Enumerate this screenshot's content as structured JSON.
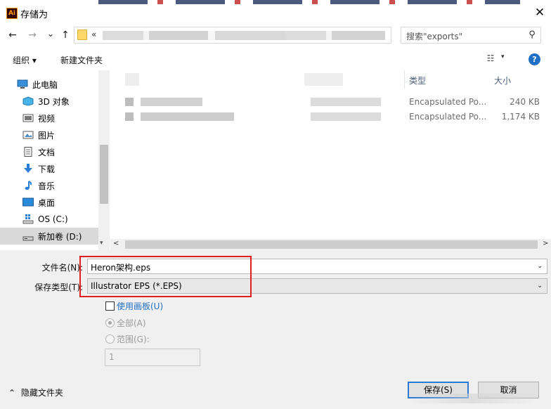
{
  "window": {
    "title": "存储为",
    "app_icon_text": "Ai",
    "close_glyph": "✕"
  },
  "nav": {
    "back_glyph": "←",
    "forward_glyph": "→",
    "recent_glyph": "⌄",
    "up_glyph": "↑",
    "breadcrumb_chevron": "«",
    "search_placeholder": "搜索\"exports\"",
    "search_glyph": "⚲"
  },
  "toolbar": {
    "organize_label": "组织 ▾",
    "new_folder_label": "新建文件夹",
    "view_glyph": "☷",
    "view_caret": "▾",
    "help_label": "?"
  },
  "tree": [
    {
      "label": "此电脑",
      "icon": "computer-icon",
      "selected": false
    },
    {
      "label": "3D 对象",
      "icon": "cube-icon",
      "selected": false
    },
    {
      "label": "视频",
      "icon": "video-icon",
      "selected": false
    },
    {
      "label": "图片",
      "icon": "picture-icon",
      "selected": false
    },
    {
      "label": "文档",
      "icon": "document-icon",
      "selected": false
    },
    {
      "label": "下载",
      "icon": "download-icon",
      "selected": false
    },
    {
      "label": "音乐",
      "icon": "music-icon",
      "selected": false
    },
    {
      "label": "桌面",
      "icon": "desktop-icon",
      "selected": false
    },
    {
      "label": "OS (C:)",
      "icon": "drive-icon",
      "selected": false
    },
    {
      "label": "新加卷 (D:)",
      "icon": "drive-icon",
      "selected": true
    }
  ],
  "columns": {
    "type": "类型",
    "size": "大小"
  },
  "files": [
    {
      "type": "Encapsulated Po...",
      "size": "240 KB"
    },
    {
      "type": "Encapsulated Po...",
      "size": "1,174 KB"
    }
  ],
  "form": {
    "filename_label": "文件名(N):",
    "filename_value": "Heron架构.eps",
    "filetype_label": "保存类型(T):",
    "filetype_value": "Illustrator EPS (*.EPS)",
    "use_artboards_label": "使用画板(U)",
    "all_label": "全部(A)",
    "range_label": "范围(G):",
    "range_value": "1",
    "combo_caret": "⌄"
  },
  "footer": {
    "hide_folders_label": "隐藏文件夹",
    "hide_glyph": "⌃",
    "save_label": "保存(S)",
    "cancel_label": "取消"
  },
  "colors": {
    "accent": "#2a7ad6",
    "highlight_box": "#e02020",
    "link": "#1f6fc5"
  }
}
